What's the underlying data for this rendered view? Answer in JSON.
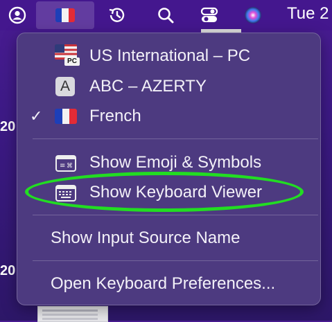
{
  "menubar": {
    "icons": [
      "user-circle-icon",
      "flag-icon",
      "time-machine-icon",
      "search-icon",
      "control-center-icon",
      "siri-icon"
    ],
    "clock": "Tue 2"
  },
  "desktop": {
    "labels": [
      "20",
      "20"
    ]
  },
  "input_menu": {
    "sources": [
      {
        "label": "US International – PC",
        "icon": "us-flag-pc-icon",
        "checked": false
      },
      {
        "label": "ABC – AZERTY",
        "icon": "abc-icon",
        "icon_text": "A",
        "checked": false
      },
      {
        "label": "French",
        "icon": "french-flag-icon",
        "checked": true
      }
    ],
    "pc_tag": "PC",
    "check_mark": "✓",
    "actions": [
      {
        "label": "Show Emoji & Symbols",
        "icon": "emoji-symbols-icon"
      },
      {
        "label": "Show Keyboard Viewer",
        "icon": "keyboard-viewer-icon"
      }
    ],
    "show_input_source_name": "Show Input Source Name",
    "open_preferences": "Open Keyboard Preferences..."
  },
  "annotation": {
    "highlight_color": "#22dd22",
    "highlighted_item": "Show Keyboard Viewer"
  },
  "colors": {
    "menubar_bg": "#44178e",
    "menu_bg": "#4d3a80",
    "flag_blue": "#1d3fb8",
    "flag_red": "#e32b36"
  }
}
